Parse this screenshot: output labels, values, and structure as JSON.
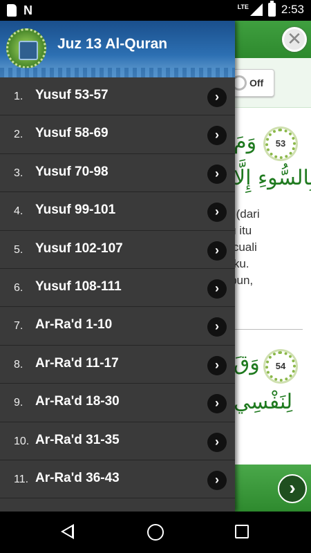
{
  "status_bar": {
    "network": "LTE",
    "time": "2:53",
    "notif_icon": "N"
  },
  "drawer": {
    "title": "Juz 13 Al-Quran",
    "items": [
      {
        "num": "1.",
        "label": "Yusuf 53-57"
      },
      {
        "num": "2.",
        "label": "Yusuf 58-69"
      },
      {
        "num": "3.",
        "label": "Yusuf 70-98"
      },
      {
        "num": "4.",
        "label": "Yusuf 99-101"
      },
      {
        "num": "5.",
        "label": "Yusuf 102-107"
      },
      {
        "num": "6.",
        "label": "Yusuf 108-111"
      },
      {
        "num": "7.",
        "label": "Ar-Ra'd 1-10"
      },
      {
        "num": "8.",
        "label": "Ar-Ra'd 11-17"
      },
      {
        "num": "9.",
        "label": "Ar-Ra'd 18-30"
      },
      {
        "num": "10.",
        "label": "Ar-Ra'd 31-35"
      },
      {
        "num": "11.",
        "label": "Ar-Ra'd 36-43"
      }
    ]
  },
  "background": {
    "close_glyph": "✕",
    "toggle_label": "Off",
    "ayah1": {
      "number": "53",
      "arabic_top": "وَمَ",
      "arabic_bottom": "بِالسُّوءِ إِلَّا"
    },
    "translation_lines": [
      "ebas (dari",
      "nafsu itu",
      "n, kecuali",
      "uhanku.",
      "gampun,"
    ],
    "ayah2": {
      "number": "54",
      "arabic_top": "وَقَ",
      "arabic_bottom": "لِنَفْسِي"
    },
    "next_glyph": "›"
  },
  "colors": {
    "accent": "#2e8a2e",
    "drawer_bg": "#3a3a3a",
    "header_blue": "#2c6fb2"
  }
}
